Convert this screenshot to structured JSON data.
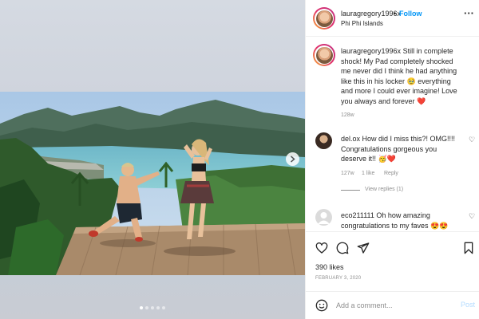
{
  "post": {
    "username": "lauragregory1996x",
    "separator": "•",
    "follow_label": "Follow",
    "location": "Phi Phi Islands",
    "more_icon": "more-horizontal-icon"
  },
  "caption": {
    "username": "lauragregory1996x",
    "text_line1": " Still in complete",
    "text_line2": "shock! My Pad completely shocked",
    "text_line3": "me never did I think he had anything",
    "text_line4": "like this in his locker 🥹 everything",
    "text_line5": "and more I could ever imagine! Love",
    "text_line6": "you always and forever ❤️",
    "time": "128w"
  },
  "comments": [
    {
      "username": "del.ox",
      "line1": " How did I miss this?! OMG!!!!",
      "line2": "Congratulations gorgeous you",
      "line3": "deserve it!! 🥳❤️",
      "time": "127w",
      "likes": "1 like",
      "reply": "Reply",
      "view_replies": "View replies (1)"
    },
    {
      "username": "eco211111",
      "line1": " Oh how amazing",
      "line2": "congratulations to my faves 😍😍"
    }
  ],
  "likes_count": "390 likes",
  "date": "FEBRUARY 3, 2020",
  "comment_box": {
    "placeholder": "Add a comment...",
    "post_label": "Post"
  },
  "media": {
    "next_icon": "chevron-right-icon",
    "dots": 5,
    "active_dot": 1
  },
  "colors": {
    "accent": "#0095f6",
    "heart": "#ed4956",
    "muted": "#8e8e8e"
  }
}
